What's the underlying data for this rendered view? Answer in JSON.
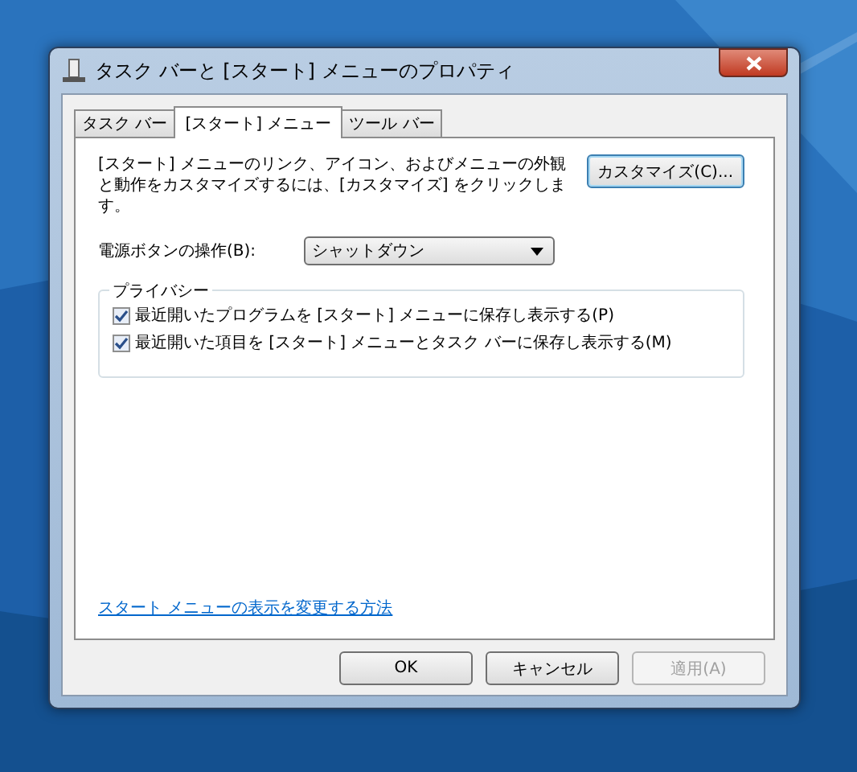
{
  "window": {
    "title": "タスク バーと [スタート] メニューのプロパティ"
  },
  "tabs": [
    {
      "label": "タスク バー",
      "selected": false
    },
    {
      "label": "[スタート] メニュー",
      "selected": true
    },
    {
      "label": "ツール バー",
      "selected": false
    }
  ],
  "description": "[スタート] メニューのリンク、アイコン、およびメニューの外観と動作をカスタマイズするには、[カスタマイズ] をクリックします。",
  "customize_button": "カスタマイズ(C)...",
  "power_button": {
    "label": "電源ボタンの操作(B):",
    "value": "シャットダウン"
  },
  "privacy": {
    "title": "プライバシー",
    "options": [
      {
        "label": "最近開いたプログラムを [スタート] メニューに保存し表示する(P)",
        "checked": true
      },
      {
        "label": "最近開いた項目を [スタート] メニューとタスク バーに保存し表示する(M)",
        "checked": true
      }
    ]
  },
  "help_link": "スタート メニューの表示を変更する方法",
  "buttons": [
    {
      "label": "OK",
      "disabled": false
    },
    {
      "label": "キャンセル",
      "disabled": false
    },
    {
      "label": "適用(A)",
      "disabled": true
    }
  ]
}
